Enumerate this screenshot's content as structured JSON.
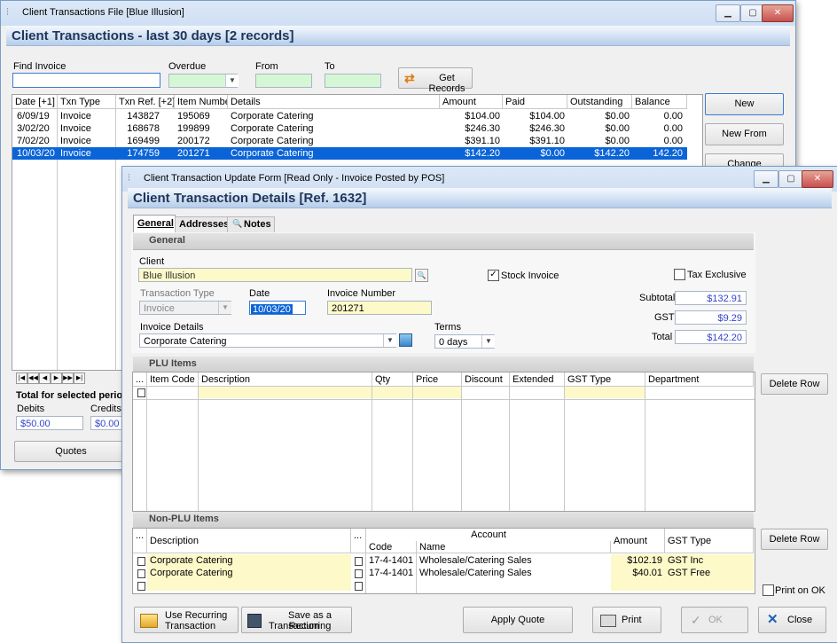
{
  "back_window": {
    "title": "Client Transactions File [Blue Illusion]",
    "header": "Client Transactions - last 30 days [2 records]",
    "filters": {
      "find_invoice_label": "Find Invoice",
      "overdue_label": "Overdue",
      "from_label": "From",
      "to_label": "To",
      "get_records_label": "Get Records"
    },
    "columns": [
      "Date [+1]",
      "Txn Type",
      "Txn Ref. [+2]",
      "Item Number",
      "Details",
      "Amount",
      "Paid",
      "Outstanding",
      "Balance"
    ],
    "rows": [
      {
        "date": "6/09/19",
        "type": "Invoice",
        "ref": "143827",
        "item": "195069",
        "details": "Corporate Catering",
        "amount": "$104.00",
        "paid": "$104.00",
        "outstanding": "$0.00",
        "balance": "0.00"
      },
      {
        "date": "3/02/20",
        "type": "Invoice",
        "ref": "168678",
        "item": "199899",
        "details": "Corporate Catering",
        "amount": "$246.30",
        "paid": "$246.30",
        "outstanding": "$0.00",
        "balance": "0.00"
      },
      {
        "date": "7/02/20",
        "type": "Invoice",
        "ref": "169499",
        "item": "200172",
        "details": "Corporate Catering",
        "amount": "$391.10",
        "paid": "$391.10",
        "outstanding": "$0.00",
        "balance": "0.00"
      },
      {
        "date": "10/03/20",
        "type": "Invoice",
        "ref": "174759",
        "item": "201271",
        "details": "Corporate Catering",
        "amount": "$142.20",
        "paid": "$0.00",
        "outstanding": "$142.20",
        "balance": "142.20"
      }
    ],
    "buttons": {
      "new": "New",
      "new_from": "New From",
      "change": "Change",
      "quotes": "Quotes"
    },
    "totals": {
      "title": "Total for selected period",
      "debits_label": "Debits",
      "credits_label": "Credits",
      "debits": "$50.00",
      "credits": "$0.00"
    }
  },
  "front_window": {
    "title": "Client Transaction Update Form [Read Only - Invoice Posted by POS]",
    "header": "Client Transaction Details [Ref. 1632]",
    "tabs": [
      "General",
      "Addresses",
      "Notes"
    ],
    "general_section": "General",
    "client_label": "Client",
    "client_value": "Blue Illusion",
    "stock_invoice_label": "Stock Invoice",
    "tax_exclusive_label": "Tax Exclusive",
    "transaction_type_label": "Transaction Type",
    "transaction_type_value": "Invoice",
    "date_label": "Date",
    "date_value": "10/03/20",
    "invoice_number_label": "Invoice Number",
    "invoice_number_value": "201271",
    "invoice_details_label": "Invoice Details",
    "invoice_details_value": "Corporate Catering",
    "terms_label": "Terms",
    "terms_value": "0 days",
    "subtotal_label": "Subtotal",
    "subtotal_value": "$132.91",
    "gst_label": "GST",
    "gst_value": "$9.29",
    "total_label": "Total",
    "total_value": "$142.20",
    "plu_section": "PLU Items",
    "plu_columns": [
      "...",
      "Item Code",
      "Description",
      "Qty",
      "Price",
      "Discount",
      "Extended",
      "GST Type",
      "Department"
    ],
    "delete_row_label": "Delete Row",
    "non_plu_section": "Non-PLU Items",
    "non_plu_account_group": "Account",
    "non_plu_columns": [
      "...",
      "Description",
      "...",
      "Code",
      "Name",
      "Amount",
      "GST Type"
    ],
    "non_plu_rows": [
      {
        "description": "Corporate Catering",
        "code": "17-4-1401",
        "name": "Wholesale/Catering Sales",
        "amount": "$102.19",
        "gst": "GST Inc"
      },
      {
        "description": "Corporate Catering",
        "code": "17-4-1401",
        "name": "Wholesale/Catering Sales",
        "amount": "$40.01",
        "gst": "GST Free"
      }
    ],
    "print_on_ok_label": "Print on OK",
    "footer_buttons": {
      "use_recurring_1": "Use Recurring",
      "use_recurring_2": "Transaction",
      "save_recurring_1": "Save as a Recurring",
      "save_recurring_2": "Transaction",
      "apply_quote": "Apply Quote",
      "print": "Print",
      "ok": "OK",
      "close": "Close"
    }
  }
}
